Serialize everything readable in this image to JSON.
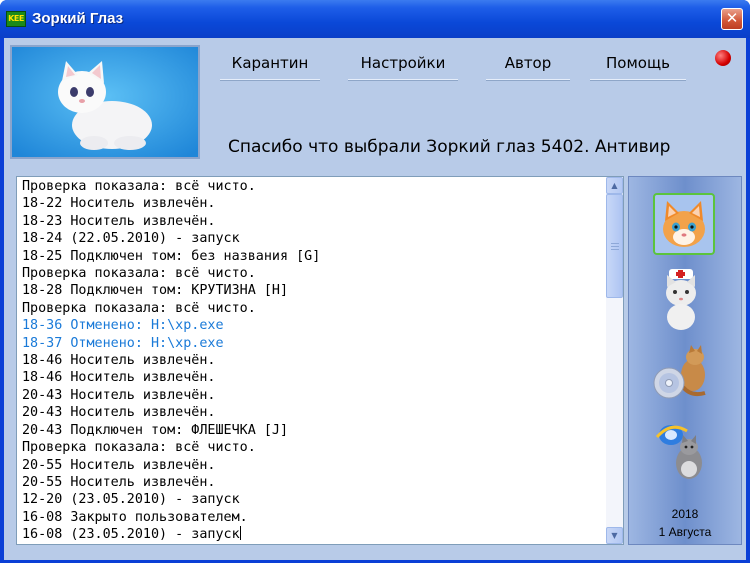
{
  "window": {
    "title": "Зоркий Глаз",
    "app_icon_text": "KEE",
    "close_glyph": "✕"
  },
  "menu": [
    {
      "label": "Карантин"
    },
    {
      "label": "Настройки"
    },
    {
      "label": "Автор"
    },
    {
      "label": "Помощь"
    }
  ],
  "marquee": "Спасибо что выбрали Зоркий глаз 5402.   Антивир",
  "log": [
    {
      "text": "Проверка показала: всё чисто.",
      "color": "black"
    },
    {
      "text": "18-22 Носитель извлечён.",
      "color": "black"
    },
    {
      "text": "18-23 Носитель извлечён.",
      "color": "black"
    },
    {
      "text": "18-24 (22.05.2010) - запуск",
      "color": "black"
    },
    {
      "text": "18-25 Подключен том: без названия [G]",
      "color": "black"
    },
    {
      "text": "Проверка показала: всё чисто.",
      "color": "black"
    },
    {
      "text": "18-28 Подключен том: КРУТИЗНА [H]",
      "color": "black"
    },
    {
      "text": "Проверка показала: всё чисто.",
      "color": "black"
    },
    {
      "text": "18-36 Отменено: H:\\xp.exe",
      "color": "blue"
    },
    {
      "text": "18-37 Отменено: H:\\xp.exe",
      "color": "blue"
    },
    {
      "text": "18-46 Носитель извлечён.",
      "color": "black"
    },
    {
      "text": "18-46 Носитель извлечён.",
      "color": "black"
    },
    {
      "text": "20-43 Носитель извлечён.",
      "color": "black"
    },
    {
      "text": "20-43 Носитель извлечён.",
      "color": "black"
    },
    {
      "text": "20-43 Подключен том: ФЛЕШЕЧКА [J]",
      "color": "black"
    },
    {
      "text": "Проверка показала: всё чисто.",
      "color": "black"
    },
    {
      "text": "20-55 Носитель извлечён.",
      "color": "black"
    },
    {
      "text": "20-55 Носитель извлечён.",
      "color": "black"
    },
    {
      "text": "12-20 (23.05.2010) - запуск",
      "color": "black"
    },
    {
      "text": "16-08 Закрыто пользователем.",
      "color": "black"
    },
    {
      "text": "16-08 (23.05.2010) - запуск",
      "color": "black"
    }
  ],
  "side_panel": {
    "icons": [
      {
        "name": "kitten-face-icon",
        "selected": true
      },
      {
        "name": "doctor-cat-icon",
        "selected": false
      },
      {
        "name": "cat-with-disc-icon",
        "selected": false
      },
      {
        "name": "cat-with-internet-explorer-icon",
        "selected": false
      }
    ],
    "date_year": "2018",
    "date_day": "1 Августа"
  },
  "colors": {
    "log_highlight": "#1a7ad8",
    "titlebar": "#0a48d8",
    "client_bg": "#b8cbe8"
  }
}
